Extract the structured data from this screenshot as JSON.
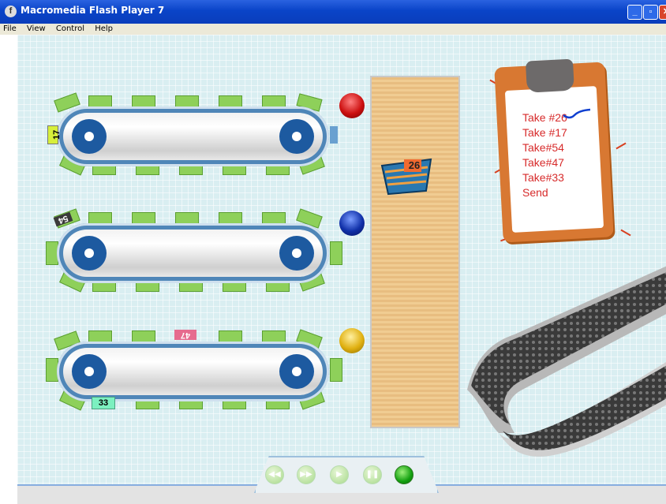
{
  "window": {
    "title": "Macromedia Flash Player 7",
    "buttons": [
      "_",
      "▫",
      "✕"
    ]
  },
  "menu": [
    "File",
    "View",
    "Control",
    "Help"
  ],
  "belts": [
    {
      "label": "17",
      "label_color": "#d7ef3b"
    },
    {
      "label": "54",
      "label_color": "#3a3a3a"
    },
    {
      "label": "47",
      "label_color": "#e66b8e"
    },
    {
      "label": "33",
      "label_color": "#7cf0c0"
    }
  ],
  "buttons": {
    "red": "#cc1010",
    "blue": "#1030a8",
    "yellow": "#e0b010"
  },
  "basket": {
    "number": "26"
  },
  "clipboard": {
    "items": [
      "Take #26",
      "Take #17",
      "Take#54",
      "Take#47",
      "Take#33",
      "Send"
    ]
  },
  "controls": [
    "rewind",
    "fast-forward",
    "play",
    "pause",
    "record"
  ]
}
